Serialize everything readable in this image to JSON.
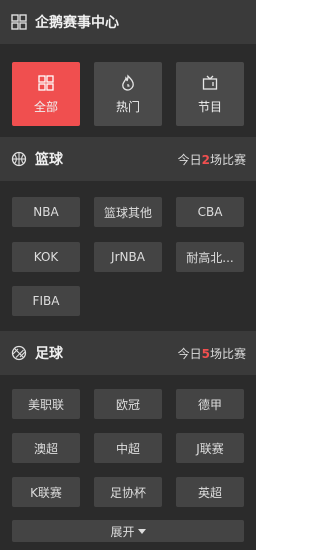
{
  "header": {
    "title": "企鹅赛事中心",
    "icon": "grid-icon"
  },
  "tabs": [
    {
      "label": "全部",
      "icon": "grid-icon",
      "active": true
    },
    {
      "label": "热门",
      "icon": "flame-icon",
      "active": false
    },
    {
      "label": "节目",
      "icon": "tv-icon",
      "active": false
    }
  ],
  "basketball": {
    "title": "篮球",
    "icon": "basketball-icon",
    "today_prefix": "今日",
    "today_count": "2",
    "today_suffix": "场比赛",
    "leagues": [
      "NBA",
      "篮球其他",
      "CBA",
      "KOK",
      "JrNBA",
      "耐高北...",
      "FIBA"
    ]
  },
  "football": {
    "title": "足球",
    "icon": "soccer-ball-icon",
    "today_prefix": "今日",
    "today_count": "5",
    "today_suffix": "场比赛",
    "leagues": [
      "美职联",
      "欧冠",
      "德甲",
      "澳超",
      "中超",
      "J联赛",
      "K联赛",
      "足协杯",
      "英超"
    ]
  },
  "expand_label": "展开",
  "colors": {
    "accent": "#f04f4f",
    "panel": "#2b2b2b",
    "header": "#3a3a3a",
    "chip": "#444444"
  }
}
